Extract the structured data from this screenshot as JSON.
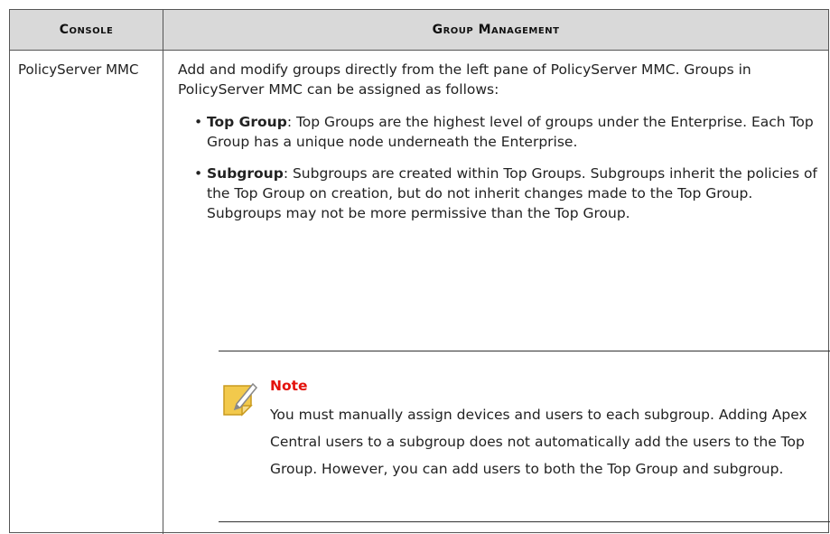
{
  "header": {
    "col1": "Console",
    "col2": "Group Management"
  },
  "row": {
    "console": "PolicyServer MMC",
    "intro": "Add and modify groups directly from the left pane of PolicyServer MMC. Groups in PolicyServer MMC can be assigned as follows:",
    "bullets": [
      {
        "term": "Top Group",
        "text": ": Top Groups are the highest level of groups under the Enterprise. Each Top Group has a unique node underneath the Enterprise."
      },
      {
        "term": "Subgroup",
        "text": ": Subgroups are created within Top Groups. Subgroups inherit the policies of the Top Group on creation, but do not inherit changes made to the Top Group. Subgroups may not be more permissive than the Top Group."
      }
    ],
    "note": {
      "icon": "note-pencil-icon",
      "title": "Note",
      "text": "You must manually assign devices and users to each subgroup. Adding Apex Central users to a subgroup does not automatically add the users to the Top Group. However, you can add users to both the Top Group and subgroup."
    }
  },
  "colors": {
    "header_bg": "#d9d9d9",
    "note_title": "#e3120b",
    "note_icon": "#f2c94c"
  }
}
